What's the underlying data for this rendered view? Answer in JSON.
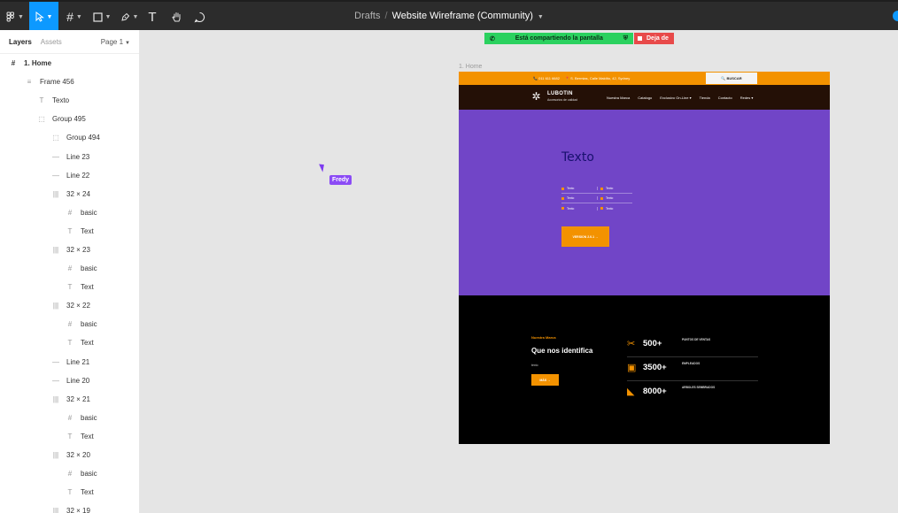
{
  "toolbar": {
    "main_menu_icon": "figma-menu-icon",
    "move_tool_icon": "cursor-arrow-icon",
    "frame_tool_icon": "frame-hash-icon",
    "shape_tool_icon": "rectangle-icon",
    "pen_tool_icon": "pen-icon",
    "text_tool_glyph": "T",
    "hand_tool_icon": "hand-icon",
    "comment_tool_icon": "comment-icon",
    "breadcrumb_drafts": "Drafts",
    "breadcrumb_separator": "/",
    "file_name": "Website Wireframe (Community)",
    "accent_color": "#0d99ff"
  },
  "sidebar": {
    "tabs": [
      "Layers",
      "Assets"
    ],
    "active_tab": "Layers",
    "page_selector": "Page 1",
    "layers": [
      {
        "icon": "#",
        "label": "1. Home",
        "indent": 0,
        "top": true
      },
      {
        "icon": "≡",
        "label": "Frame 456",
        "indent": 1
      },
      {
        "icon": "T",
        "label": "Texto",
        "indent": 2
      },
      {
        "icon": "⬚",
        "label": "Group 495",
        "indent": 2
      },
      {
        "icon": "⬚",
        "label": "Group 494",
        "indent": 3
      },
      {
        "icon": "—",
        "label": "Line 23",
        "indent": 3
      },
      {
        "icon": "—",
        "label": "Line 22",
        "indent": 3
      },
      {
        "icon": "|||",
        "label": "32 × 24",
        "indent": 3
      },
      {
        "icon": "#",
        "label": "basic",
        "indent": 4
      },
      {
        "icon": "T",
        "label": "Text",
        "indent": 4
      },
      {
        "icon": "|||",
        "label": "32 × 23",
        "indent": 3
      },
      {
        "icon": "#",
        "label": "basic",
        "indent": 4
      },
      {
        "icon": "T",
        "label": "Text",
        "indent": 4
      },
      {
        "icon": "|||",
        "label": "32 × 22",
        "indent": 3
      },
      {
        "icon": "#",
        "label": "basic",
        "indent": 4
      },
      {
        "icon": "T",
        "label": "Text",
        "indent": 4
      },
      {
        "icon": "—",
        "label": "Line 21",
        "indent": 3
      },
      {
        "icon": "—",
        "label": "Line 20",
        "indent": 3
      },
      {
        "icon": "|||",
        "label": "32 × 21",
        "indent": 3
      },
      {
        "icon": "#",
        "label": "basic",
        "indent": 4
      },
      {
        "icon": "T",
        "label": "Text",
        "indent": 4
      },
      {
        "icon": "|||",
        "label": "32 × 20",
        "indent": 3
      },
      {
        "icon": "#",
        "label": "basic",
        "indent": 4
      },
      {
        "icon": "T",
        "label": "Text",
        "indent": 4
      },
      {
        "icon": "|||",
        "label": "32 × 19",
        "indent": 3
      }
    ]
  },
  "canvas": {
    "share_text": "Está compartiendo la pantalla",
    "stop_text": "Deja de",
    "frame_label": "1. Home",
    "collaborator": "Fredy",
    "collaborator_color": "#8b4bf5"
  },
  "site": {
    "phone": "📞 011 611 6682",
    "address": "📍 S. Bermias, Calle Maldito, 42, Sydney",
    "search_label": "🔍 BUSCAR",
    "brand": "LUBOTIN",
    "brand_sub": "Accesorios de calidad",
    "nav": [
      "Nuestra Marca",
      "Catalogo",
      "Exclusivo On-Line ▾",
      "Tienda",
      "Contacto",
      "Redes ▾"
    ],
    "hero_title": "Texto",
    "hero_list": [
      [
        "Texto",
        "Texto"
      ],
      [
        "Texto",
        "Texto"
      ],
      [
        "Texto",
        "Texto"
      ]
    ],
    "hero_button": "VERSION 2.0.1  →",
    "eyebrow": "Nuestra Marca",
    "dark_title": "Que nos identifica",
    "dark_text": "texto",
    "dark_button": "MÁS  →",
    "stats": [
      {
        "icon": "✂",
        "value": "500+",
        "label": "PUNTOS DE VENTAS"
      },
      {
        "icon": "▣",
        "value": "3500+",
        "label": "EMPLEADOS"
      },
      {
        "icon": "◣",
        "value": "8000+",
        "label": "ARBOLES SEMBRADOS"
      }
    ],
    "colors": {
      "orange": "#f39200",
      "purple": "#7145c7",
      "dark": "#000000",
      "nav": "#241006"
    }
  }
}
